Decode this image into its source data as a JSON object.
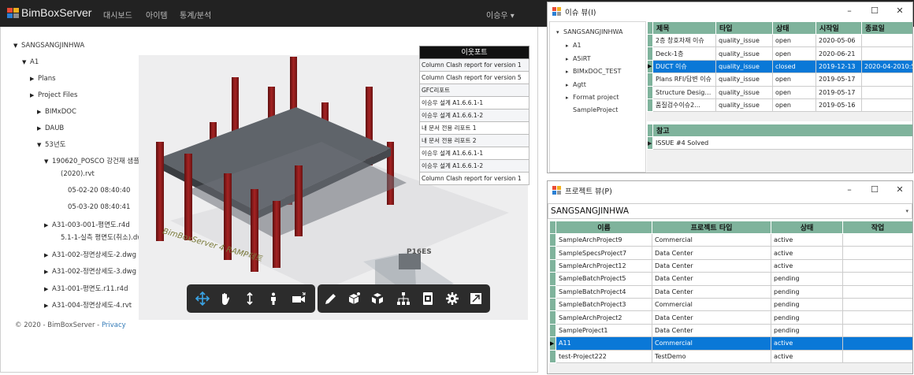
{
  "web": {
    "brand": "BimBoxServer",
    "nav": [
      "대시보드",
      "아이템",
      "통계/분석"
    ],
    "user": "이승우 ▾",
    "tree": [
      {
        "label": "SANGSANGJINHWA",
        "arrow": "▼"
      },
      {
        "label": "A1",
        "arrow": "▼"
      },
      {
        "label": "Plans",
        "arrow": "▶"
      },
      {
        "label": "Project Files",
        "arrow": "▶"
      },
      {
        "label": "BIMxDOC",
        "arrow": "▶"
      },
      {
        "label": "DAUB",
        "arrow": "▶"
      },
      {
        "label": "53년도",
        "arrow": "▼"
      },
      {
        "label": "190620_POSCO 강건재 샘플",
        "arrow": "▼"
      },
      {
        "label": "(2020).rvt",
        "arrow": ""
      },
      {
        "label": "05-02-20 08:40:40",
        "arrow": ""
      },
      {
        "label": "05-03-20 08:40:41",
        "arrow": ""
      },
      {
        "label": "A31-003-001-평면도.r4d",
        "arrow": "▶"
      },
      {
        "label": "5.1-1-실측 평면도(취소).dwg",
        "arrow": ""
      },
      {
        "label": "A31-002-정면상세도-2.dwg",
        "arrow": "▶"
      },
      {
        "label": "A31-002-정면상세도-3.dwg",
        "arrow": "▶"
      },
      {
        "label": "A31-001-평면도.r11.r4d",
        "arrow": "▶"
      },
      {
        "label": "A31-004-정면상세도-4.rvt",
        "arrow": "▶"
      }
    ],
    "copyright": "© 2020 - BimBoxServer - ",
    "privacy": "Privacy",
    "export_title": "이웃포트",
    "export_rows": [
      "Column Clash report for version 1",
      "Column Clash report for version 5",
      "GFC리포트",
      "이승우 설계 A1.6.6.1-1",
      "이승우 설계 A1.6.6.1-2",
      "내 문서 전용 리포트 1",
      "내 문서 전용 리포트 2",
      "이승우 설계 A1.6.6.1-1",
      "이승우 설계 A1.6.6.1-2",
      "Column Clash report for version 1"
    ],
    "watermark": "BimBoxServer 4 RAMP테트",
    "model_label": "P16ES"
  },
  "issue_win": {
    "title": "이슈 뷰(I)",
    "tree": [
      {
        "label": "SANGSANGJINHWA",
        "arrow": "▾"
      },
      {
        "label": "A1",
        "arrow": "▸"
      },
      {
        "label": "A5iRT",
        "arrow": "▸"
      },
      {
        "label": "BIMxDOC_TEST",
        "arrow": "▸"
      },
      {
        "label": "Agtt",
        "arrow": "▸"
      },
      {
        "label": "Format project",
        "arrow": "▸"
      },
      {
        "label": "SampleProject",
        "arrow": ""
      }
    ],
    "columns": [
      "제목",
      "타입",
      "상태",
      "시작일",
      "종료일"
    ],
    "rows": [
      [
        "2층 창호자재 이슈",
        "quality_issue",
        "open",
        "2020-05-06",
        ""
      ],
      [
        "Deck-1층",
        "quality_issue",
        "open",
        "2020-06-21",
        ""
      ],
      [
        "DUCT 이슈",
        "quality_issue",
        "closed",
        "2019-12-13",
        "2020-04-2010:5"
      ],
      [
        "Plans RFI/답변 이슈",
        "quality_issue",
        "open",
        "2019-05-17",
        ""
      ],
      [
        "Structure Design R...",
        "quality_issue",
        "open",
        "2019-05-17",
        ""
      ],
      [
        "품질검수이슈2...",
        "quality_issue",
        "open",
        "2019-05-16",
        ""
      ]
    ],
    "selected_row": 2,
    "ref_header": "참고",
    "ref_rows": [
      "ISSUE #4 Solved"
    ]
  },
  "proj_win": {
    "title": "프로젝트 뷰(P)",
    "combo": "SANGSANGJINHWA",
    "columns": [
      "이름",
      "프로젝트 타입",
      "상태",
      "작업"
    ],
    "rows": [
      [
        "SampleArchProject9",
        "Commercial",
        "active",
        ""
      ],
      [
        "SampleSpecsProject7",
        "Data Center",
        "active",
        ""
      ],
      [
        "SampleArchProject12",
        "Data Center",
        "active",
        ""
      ],
      [
        "SampleBatchProject5",
        "Data Center",
        "pending",
        ""
      ],
      [
        "SampleBatchProject4",
        "Data Center",
        "pending",
        ""
      ],
      [
        "SampleBatchProject3",
        "Commercial",
        "pending",
        ""
      ],
      [
        "SampleArchProject2",
        "Data Center",
        "pending",
        ""
      ],
      [
        "SampleProject1",
        "Data Center",
        "pending",
        ""
      ],
      [
        "A11",
        "Commercial",
        "active",
        ""
      ],
      [
        "test-Project222",
        "TestDemo",
        "active",
        ""
      ]
    ],
    "selected_row": 8
  },
  "colors": {
    "grid_header": "#7fb39c",
    "selection": "#0a78d7",
    "navbar": "#222222",
    "column_red": "#8b1a1a",
    "slab": "#5d6166"
  },
  "icons": {
    "toolbar1": [
      "move-icon",
      "hand-icon",
      "updown-icon",
      "person-icon",
      "camera-icon"
    ],
    "toolbar2": [
      "pencil-icon",
      "box-add-icon",
      "box-explode-icon",
      "hierarchy-icon",
      "properties-icon",
      "gear-icon",
      "fullscreen-icon"
    ]
  }
}
